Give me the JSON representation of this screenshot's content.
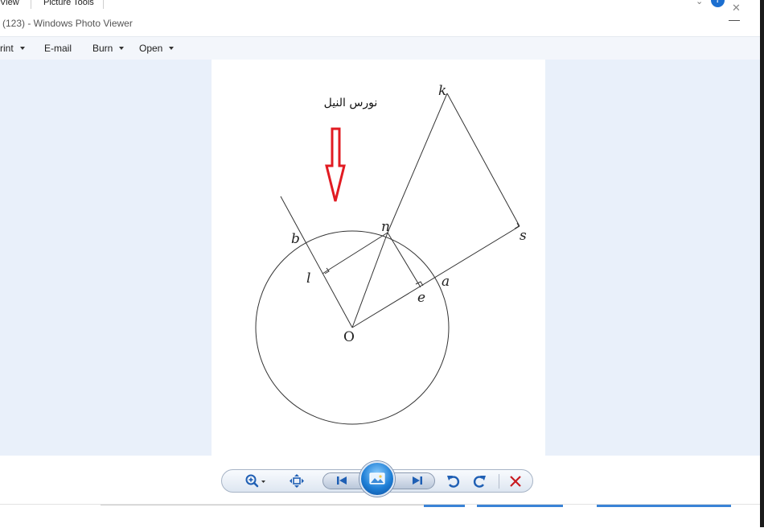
{
  "background_window": {
    "tab_view": "View",
    "tab_picture_tools": "Picture Tools",
    "help_icon": "?",
    "chevron_icon": "chevron-down-icon",
    "close_icon": "close-icon"
  },
  "window": {
    "title": "(123) - Windows Photo Viewer",
    "minimize_icon": "minimize-icon"
  },
  "menu": {
    "print": "rint",
    "email": "E-mail",
    "burn": "Burn",
    "open": "Open"
  },
  "photo": {
    "watermark": "نورس النيل",
    "labels": {
      "k": "k",
      "b": "b",
      "n": "n",
      "s": "s",
      "l": "l",
      "a": "a",
      "e": "e",
      "o": "O"
    }
  },
  "toolbar": {
    "icons": [
      "zoom-icon",
      "actual-size-icon",
      "previous-icon",
      "slideshow-icon",
      "next-icon",
      "rotate-counterclockwise-icon",
      "rotate-clockwise-icon",
      "delete-icon"
    ]
  },
  "colors": {
    "view_background": "#e9f0fa",
    "menubar": "#f3f6fb",
    "arrow": "#e11b22",
    "toolbar_blue": "#1f5fb4",
    "delete_red": "#c8191f"
  }
}
